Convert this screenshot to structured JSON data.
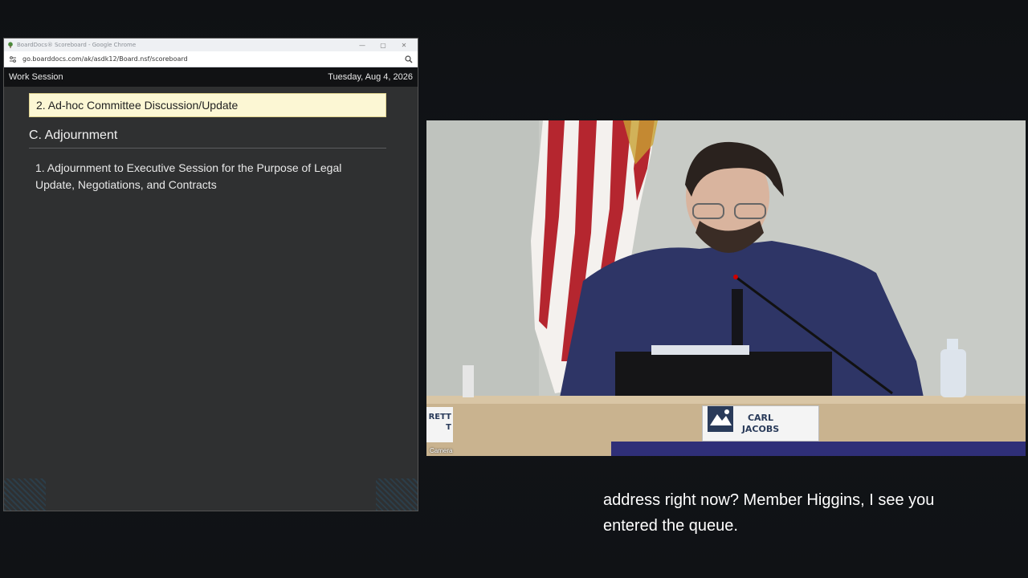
{
  "browser": {
    "window_title": "BoardDocs® Scoreboard - Google Chrome",
    "url": "go.boarddocs.com/ak/asdk12/Board.nsf/scoreboard"
  },
  "scoreboard": {
    "meeting_type": "Work Session",
    "meeting_date": "Tuesday, Aug 4, 2026",
    "current_item": "2. Ad-hoc Committee Discussion/Update",
    "section_title": "C. Adjournment",
    "next_item": "1. Adjournment to Executive Session for the Purpose of Legal Update, Negotiations, and Contracts"
  },
  "video": {
    "camera_label": "Camera",
    "nameplate_first": "CARL",
    "nameplate_last": "JACOBS",
    "nameplate_left_line1": "RETT",
    "nameplate_left_line2": "T"
  },
  "captions": {
    "line1": "address right now? Member Higgins, I see you",
    "line2": "entered the queue."
  },
  "colors": {
    "current_item_bg": "#fcf7d4",
    "header_bg": "#111214",
    "panel_bg": "#2f3031",
    "suit": "#2e3566"
  }
}
